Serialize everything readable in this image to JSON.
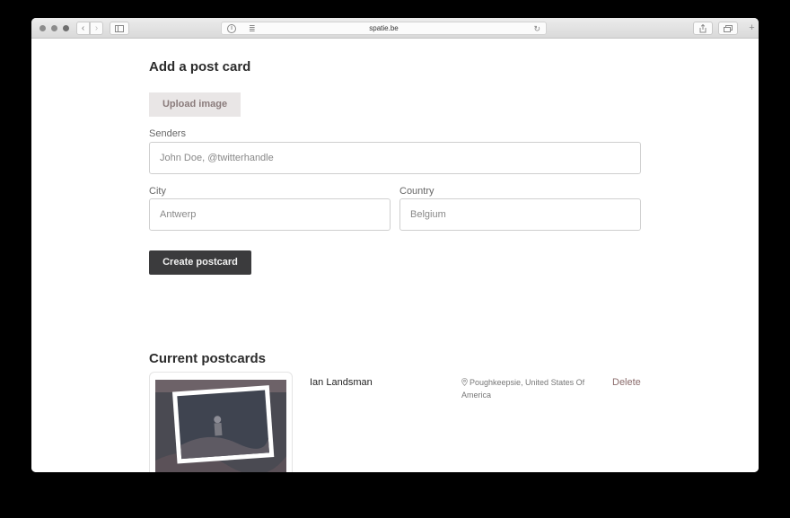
{
  "browser": {
    "url": "spatie.be",
    "back_icon": "chevron-left-icon",
    "forward_icon": "chevron-right-icon"
  },
  "form": {
    "title": "Add a post card",
    "upload_label": "Upload image",
    "senders": {
      "label": "Senders",
      "placeholder": "John Doe, @twitterhandle"
    },
    "city": {
      "label": "City",
      "placeholder": "Antwerp"
    },
    "country": {
      "label": "Country",
      "placeholder": "Belgium"
    },
    "submit_label": "Create postcard"
  },
  "postcards": {
    "title": "Current postcards",
    "items": [
      {
        "sender": "Ian Landsman",
        "location": "Poughkeepsie, United States Of America",
        "delete_label": "Delete"
      }
    ]
  }
}
